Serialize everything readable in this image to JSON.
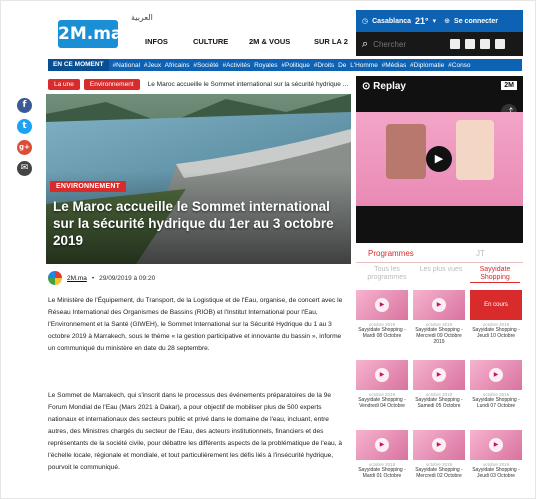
{
  "header": {
    "logo_text": "2M.ma",
    "arabic_link": "العربية",
    "nav": [
      "INFOS",
      "CULTURE",
      "2M & VOUS",
      "SUR LA 2"
    ],
    "weather_city": "Casablanca",
    "weather_temp": "21°",
    "login_label": "Se connecter",
    "search_placeholder": "Chercher",
    "accent": "#0d62b3"
  },
  "ticker": {
    "label": "EN CE MOMENT",
    "tags": "#National  #Jeux Africains  #Société  #Activités Royales  #Politique  #Droits De L'Homme  #Médias  #Diplomatie  #Conso"
  },
  "breadcrumb": {
    "home": "La une",
    "section": "Environnement",
    "current": "Le Maroc accueille le Sommet international sur la sécurité hydrique ..."
  },
  "article": {
    "category": "ENVIRONNEMENT",
    "title": "Le Maroc accueille le Sommet international sur la sécurité hydrique du 1er au 3 octobre 2019",
    "author": "2M.ma",
    "date": "29/09/2019 à 09:20",
    "p1": "Le Ministère de l'Équipement, du Transport, de la Logistique et de l'Eau, organise, de concert avec le Réseau International des Organismes de Bassins (RIOB) et l'Institut International pour l'Eau, l'Environnement et la Santé (GIWEH), le Sommet International sur la Sécurité Hydrique du 1 au 3 octobre 2019 à Marrakech, sous le thème « la gestion participative et innovante du bassin », informe un communiqué du ministère en date du 28 septembre.",
    "p2": "Le Sommet de Marrakech, qui s'inscrit dans le processus des événements préparatoires de la 9e Forum Mondial de l'Eau (Mars 2021 à Dakar), a pour objectif de mobiliser plus de 500 experts nationaux et internationaux des secteurs public et privé dans le domaine de l'eau, incluant, entre autres, des Ministres chargés du secteur de l'Eau, des acteurs institutionnels, financiers et des représentants de la société civile, pour débattre les différents aspects de la problématique de l'eau, à l'échelle locale, régionale et mondiale, et tout particulièrement les défis liés à l'insécurité hydrique, pourvoit le communiqué."
  },
  "player": {
    "title": "Replay",
    "channel": "2M"
  },
  "programmes": {
    "tab_main": "Programmes",
    "tab_other": "JT",
    "subtabs": [
      "Tous les programmes",
      "Les plus vues",
      "Sayyidate Shopping"
    ],
    "live_label": "En cours",
    "items": [
      {
        "date": "octobre 2019",
        "caption": "Sayyidate Shopping - Mardi 08 Octobre"
      },
      {
        "date": "octobre 2019",
        "caption": "Sayyidate Shopping - Mercredi 09 Octobre 2019"
      },
      {
        "date": "octobre 2019",
        "caption": "Sayyidate Shopping - Jeudi 10 Octobre"
      },
      {
        "date": "octobre 2019",
        "caption": "Sayyidate Shopping - Vendredi 04 Octobre"
      },
      {
        "date": "octobre 2019",
        "caption": "Sayyidate Shopping - Samedi 05 Octobre"
      },
      {
        "date": "octobre 2019",
        "caption": "Sayyidate Shopping - Lundi 07 Octobre"
      },
      {
        "date": "octobre 2019",
        "caption": "Sayyidate Shopping - Mardi 01 Octobre"
      },
      {
        "date": "octobre 2019",
        "caption": "Sayyidate Shopping - Mercredi 02 Octobre"
      },
      {
        "date": "octobre 2019",
        "caption": "Sayyidate Shopping - Jeudi 03 Octobre"
      }
    ]
  },
  "share": {
    "facebook": "f",
    "twitter": "t",
    "google": "g+",
    "email": "✉"
  }
}
